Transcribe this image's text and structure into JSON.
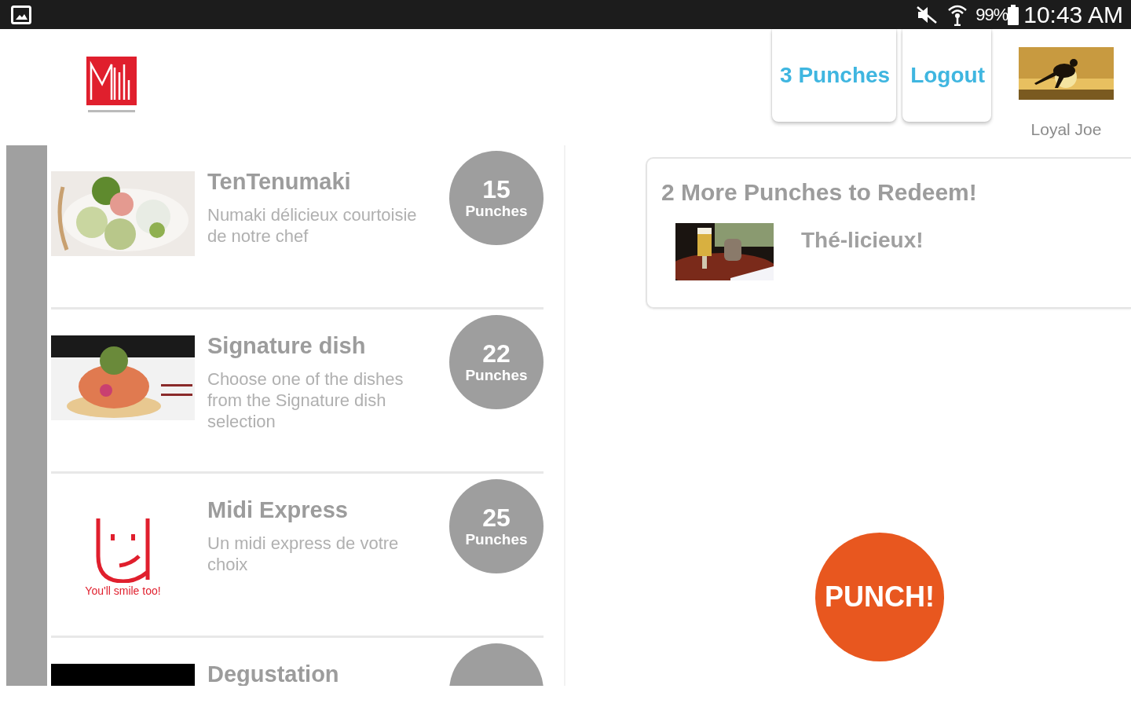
{
  "status_bar": {
    "battery": "99%",
    "time": "10:43 AM"
  },
  "header": {
    "buttons": [
      "3 Punches",
      "Logout"
    ],
    "user": {
      "name": "Loyal Joe"
    }
  },
  "rewards": [
    {
      "title": "TenTenumaki",
      "description": "Numaki délicieux courtoisie de notre chef",
      "punches": "15",
      "punches_label": "Punches"
    },
    {
      "title": "Signature dish",
      "description": "Choose one of the dishes from the Signature dish selection",
      "punches": "22",
      "punches_label": "Punches"
    },
    {
      "title": "Midi Express",
      "description": "Un midi express de votre choix",
      "punches": "25",
      "punches_label": "Punches",
      "image": {
        "kind": "logo",
        "caption": "You'll smile too!"
      }
    },
    {
      "title": "Degustation"
    }
  ],
  "redeem_card": {
    "title": "2 More Punches to Redeem!",
    "reward": {
      "name": "Thé-licieux!"
    }
  },
  "punch_button": "PUNCH!"
}
